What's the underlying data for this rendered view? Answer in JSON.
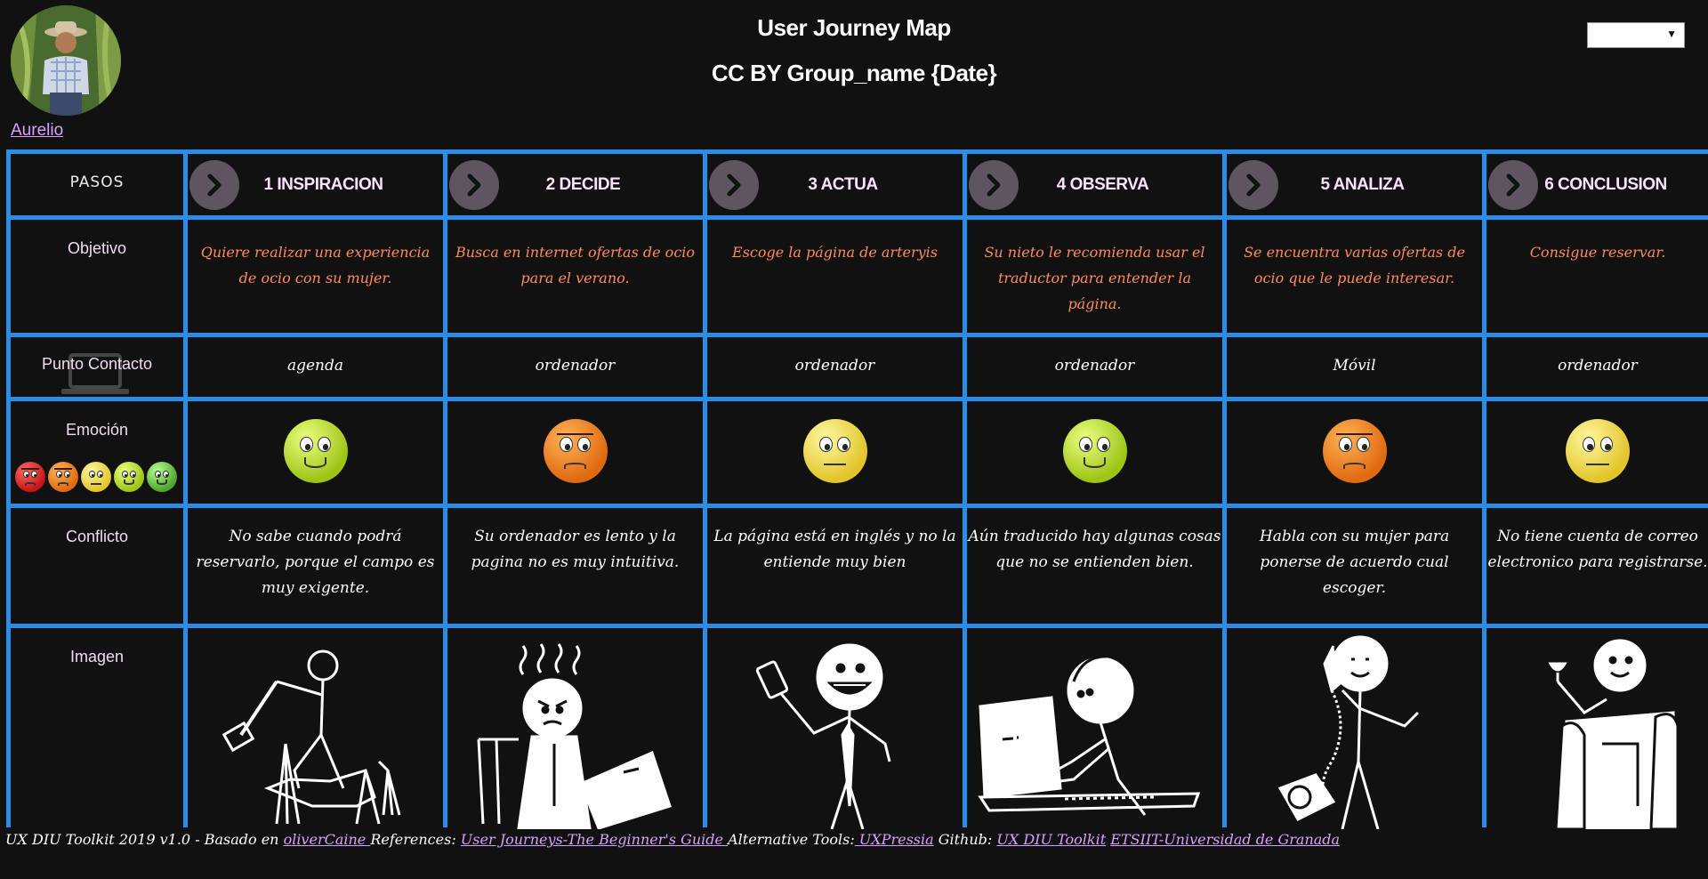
{
  "header": {
    "title": "User Journey Map",
    "subtitle": "CC BY Group_name {Date}"
  },
  "persona": {
    "name": "Aurelio",
    "avatar": "farmer-photo"
  },
  "selector": {
    "value": "",
    "icon": "chevron-down"
  },
  "row_labels": {
    "pasos": "PASOS",
    "objetivo": "Objetivo",
    "contacto": "Punto Contacto",
    "emocion": "Emoción",
    "conflicto": "Conflicto",
    "imagen": "Imagen"
  },
  "emotion_scale": [
    "very-angry",
    "angry",
    "neutral",
    "happy",
    "very-happy"
  ],
  "steps": [
    {
      "label": "1 INSPIRACION",
      "objetivo": "Quiere realizar una experiencia de ocio con su mujer.",
      "contacto": "agenda",
      "emocion": "happy",
      "conflicto": "No sabe cuando podrá reservarlo, porque el campo es muy exigente.",
      "imagen": "stickman-painting"
    },
    {
      "label": "2 DECIDE",
      "objetivo": "Busca en internet ofertas de ocio para el verano.",
      "contacto": "ordenador",
      "emocion": "angry",
      "conflicto": "Su ordenador es lento y la pagina no es muy intuitiva.",
      "imagen": "stickman-angry-laptop"
    },
    {
      "label": "3 ACTUA",
      "objetivo": "Escoge la página de arteryis",
      "contacto": "ordenador",
      "emocion": "neutral",
      "conflicto": "La página está en inglés y no la entiende muy bien",
      "imagen": "stickman-phone"
    },
    {
      "label": "4 OBSERVA",
      "objetivo": "Su nieto le recomienda usar el traductor para entender la página.",
      "contacto": "ordenador",
      "emocion": "happy",
      "conflicto": "Aún traducido hay algunas cosas que no se entienden bien.",
      "imagen": "stickman-laptop-typing"
    },
    {
      "label": "5 ANALIZA",
      "objetivo": "Se encuentra varias ofertas de ocio que le puede interesar.",
      "contacto": "Móvil",
      "emocion": "angry",
      "conflicto": "Habla con su mujer para ponerse de acuerdo cual escoger.",
      "imagen": "stickman-telephone"
    },
    {
      "label": "6 CONCLUSION",
      "objetivo": "Consigue reservar.",
      "contacto": "ordenador",
      "emocion": "neutral",
      "conflicto": "No tiene cuenta de correo electronico para registrarse.",
      "imagen": "stickman-armchair-wine"
    }
  ],
  "footer": {
    "text1": "UX DIU Toolkit 2019 v1.0 - Basado en ",
    "link1": "oliverCaine ",
    "text2": "  References: ",
    "link2": "User Journeys-The Beginner's Guide ",
    "text3": "  Alternative Tools:",
    "link3": " UXPressia",
    "text4": " Github: ",
    "link4": "UX DIU Toolkit",
    "text5": " ",
    "link5": "ETSIIT-Universidad de Granada"
  },
  "colors": {
    "background": "#111111",
    "grid": "#2a8ee8",
    "objective_text": "#ff8a5c",
    "link": "#d8a0ff",
    "chevron_bg": "#5e5560"
  }
}
